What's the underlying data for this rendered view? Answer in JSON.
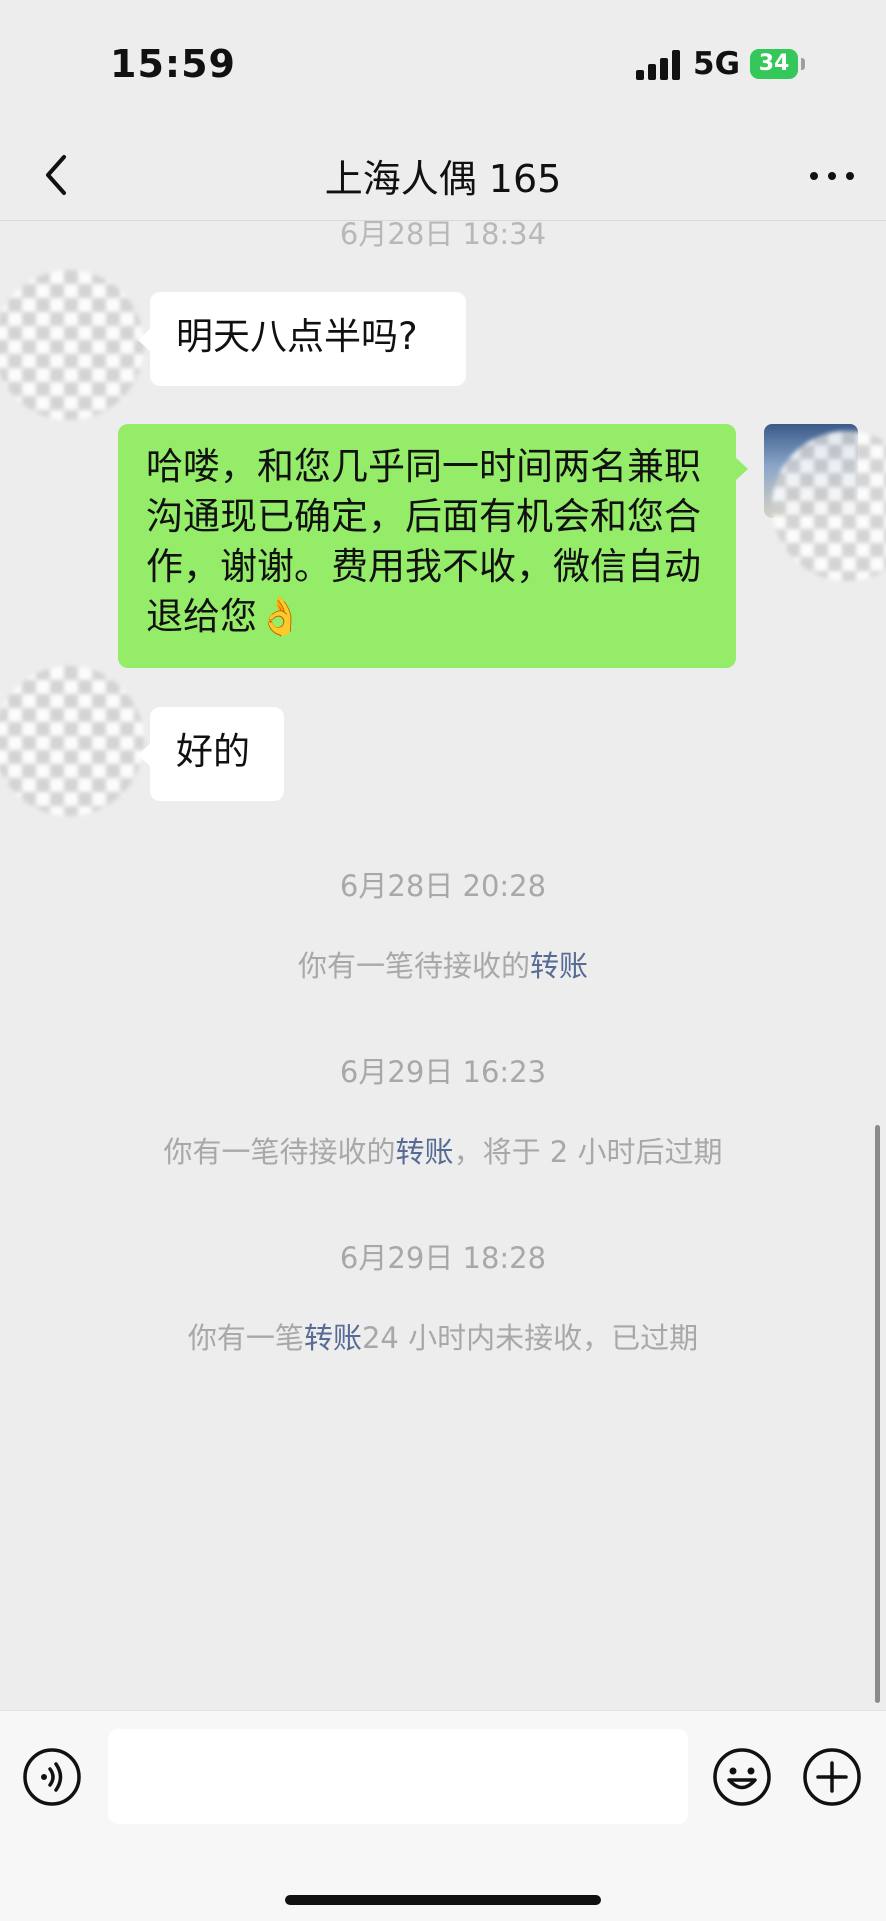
{
  "status_bar": {
    "time": "15:59",
    "network": "5G",
    "battery": "34",
    "colors": {
      "battery": "#34c759"
    }
  },
  "nav": {
    "title": "上海人偶 165",
    "back_icon": "chevron-left-icon",
    "more_icon": "more-dots-icon"
  },
  "messages": {
    "ts_top": "6月28日 18:34",
    "msg1": "明天八点半吗?",
    "msg2": "哈喽，和您几乎同一时间两名兼职沟通现已确定，后面有机会和您合作，谢谢。费用我不收，微信自动退给您👌",
    "msg3": "好的",
    "ts1": "6月28日 20:28",
    "sys1": {
      "pre": "你有一笔待接收的",
      "link": "转账",
      "post": ""
    },
    "ts2": "6月29日 16:23",
    "sys2": {
      "pre": "你有一笔待接收的",
      "link": "转账",
      "post": "，将于 2 小时后过期"
    },
    "ts3": "6月29日 18:28",
    "sys3": {
      "pre": "你有一笔",
      "link": "转账",
      "post": "24 小时内未接收，已过期"
    }
  },
  "colors": {
    "outgoing_bubble": "#95ec69",
    "incoming_bubble": "#ffffff",
    "link": "#576b95",
    "background": "#ededed"
  },
  "input_bar": {
    "voice_icon": "voice-icon",
    "emoji_icon": "emoji-icon",
    "add_icon": "plus-icon",
    "text": ""
  }
}
